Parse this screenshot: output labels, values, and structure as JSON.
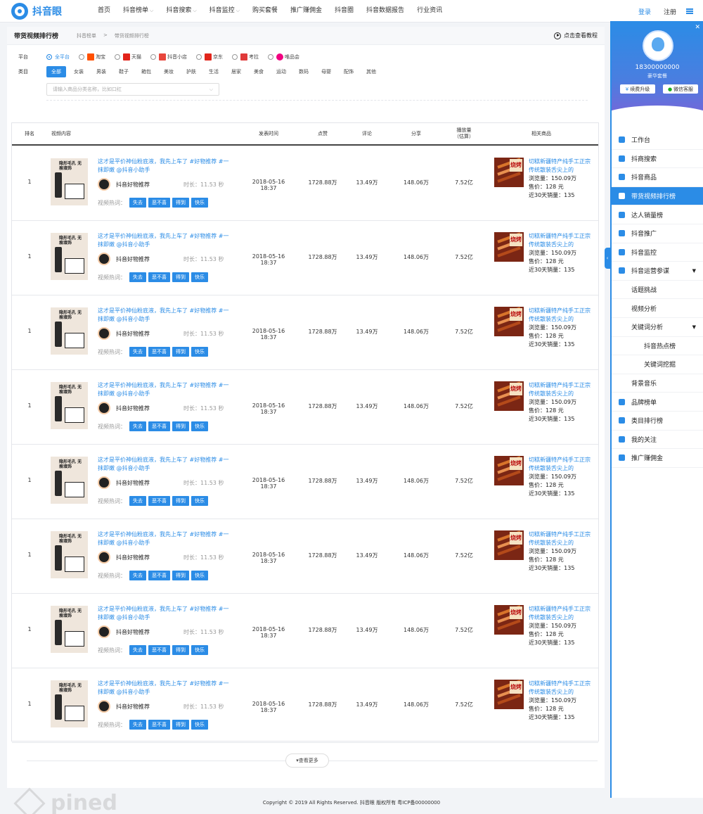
{
  "brand": {
    "name": "抖音眼"
  },
  "nav": {
    "items": [
      {
        "label": "首页",
        "caret": false
      },
      {
        "label": "抖音榜单",
        "caret": true
      },
      {
        "label": "抖音搜索",
        "caret": true
      },
      {
        "label": "抖音监控",
        "caret": true
      },
      {
        "label": "购买套餐",
        "caret": false
      },
      {
        "label": "推广赚佣金",
        "caret": false
      },
      {
        "label": "抖音圈",
        "caret": false
      },
      {
        "label": "抖音数据报告",
        "caret": false
      },
      {
        "label": "行业资讯",
        "caret": false
      }
    ],
    "login": "登录",
    "register": "注册"
  },
  "page": {
    "title": "带货视频排行榜",
    "breadcrumb": [
      "抖音榜单",
      ">",
      "带货视频排行榜"
    ],
    "tutorial": "点击查看教程"
  },
  "filters": {
    "platform_label": "平台",
    "platforms": [
      {
        "label": "全平台",
        "selected": true,
        "color": ""
      },
      {
        "label": "淘宝",
        "selected": false,
        "color": "#ff5000"
      },
      {
        "label": "天猫",
        "selected": false,
        "color": "#e2231a"
      },
      {
        "label": "抖音小店",
        "selected": false,
        "color": "#e8463c"
      },
      {
        "label": "京东",
        "selected": false,
        "color": "#e1251b"
      },
      {
        "label": "考拉",
        "selected": false,
        "color": "#e03a3a"
      },
      {
        "label": "唯品会",
        "selected": false,
        "color": "#f10180"
      }
    ],
    "category_label": "类目",
    "categories": [
      {
        "label": "全部",
        "selected": true
      },
      {
        "label": "女装",
        "selected": false
      },
      {
        "label": "男装",
        "selected": false
      },
      {
        "label": "鞋子",
        "selected": false
      },
      {
        "label": "箱包",
        "selected": false
      },
      {
        "label": "美妆",
        "selected": false
      },
      {
        "label": "护肤",
        "selected": false
      },
      {
        "label": "生活",
        "selected": false
      },
      {
        "label": "居家",
        "selected": false
      },
      {
        "label": "美食",
        "selected": false
      },
      {
        "label": "运动",
        "selected": false
      },
      {
        "label": "数码",
        "selected": false
      },
      {
        "label": "母婴",
        "selected": false
      },
      {
        "label": "配饰",
        "selected": false
      },
      {
        "label": "其他",
        "selected": false
      }
    ],
    "search_placeholder": "请输入商品分类名称，比如口红"
  },
  "table": {
    "headers": {
      "rank": "排名",
      "video": "视频内容",
      "date": "发表时间",
      "likes": "点赞",
      "comments": "评论",
      "shares": "分享",
      "plays": "播放量\n（估算）",
      "product": "相关商品"
    },
    "rows": [
      {
        "rank": "1",
        "thumb_caption": "隐形毛孔 无痕填饰",
        "title": "这才是平价神仙粉底液，我先上车了 #好物推荐 #一抹即嫩 @抖音小助手",
        "author": "抖音好物推荐",
        "duration": "时长：11.53 秒",
        "hot_label": "视频热词：",
        "tags": [
          "失去",
          "恶不喜",
          "得到",
          "快乐"
        ],
        "date": "2018-05-16 18:37",
        "likes": "1728.88万",
        "comments": "13.49万",
        "shares": "148.06万",
        "plays": "7.52亿",
        "product": {
          "thumb_label": "烧烤",
          "name": "切糕新疆特产纯手工正宗传统散装舌尖上的",
          "views": "浏览量：150.09万",
          "price": "售价：128 元",
          "sales": "近30天销量：135"
        }
      },
      {
        "rank": "1",
        "thumb_caption": "隐形毛孔 无痕填饰",
        "title": "这才是平价神仙粉底液，我先上车了 #好物推荐 #一抹即嫩 @抖音小助手",
        "author": "抖音好物推荐",
        "duration": "时长：11.53 秒",
        "hot_label": "视频热词：",
        "tags": [
          "失去",
          "恶不喜",
          "得到",
          "快乐"
        ],
        "date": "2018-05-16 18:37",
        "likes": "1728.88万",
        "comments": "13.49万",
        "shares": "148.06万",
        "plays": "7.52亿",
        "product": {
          "thumb_label": "烧烤",
          "name": "切糕新疆特产纯手工正宗传统散装舌尖上的",
          "views": "浏览量：150.09万",
          "price": "售价：128 元",
          "sales": "近30天销量：135"
        }
      },
      {
        "rank": "1",
        "thumb_caption": "隐形毛孔 无痕填饰",
        "title": "这才是平价神仙粉底液，我先上车了 #好物推荐 #一抹即嫩 @抖音小助手",
        "author": "抖音好物推荐",
        "duration": "时长：11.53 秒",
        "hot_label": "视频热词：",
        "tags": [
          "失去",
          "恶不喜",
          "得到",
          "快乐"
        ],
        "date": "2018-05-16 18:37",
        "likes": "1728.88万",
        "comments": "13.49万",
        "shares": "148.06万",
        "plays": "7.52亿",
        "product": {
          "thumb_label": "烧烤",
          "name": "切糕新疆特产纯手工正宗传统散装舌尖上的",
          "views": "浏览量：150.09万",
          "price": "售价：128 元",
          "sales": "近30天销量：135"
        }
      },
      {
        "rank": "1",
        "thumb_caption": "隐形毛孔 无痕填饰",
        "title": "这才是平价神仙粉底液，我先上车了 #好物推荐 #一抹即嫩 @抖音小助手",
        "author": "抖音好物推荐",
        "duration": "时长：11.53 秒",
        "hot_label": "视频热词：",
        "tags": [
          "失去",
          "恶不喜",
          "得到",
          "快乐"
        ],
        "date": "2018-05-16 18:37",
        "likes": "1728.88万",
        "comments": "13.49万",
        "shares": "148.06万",
        "plays": "7.52亿",
        "product": {
          "thumb_label": "烧烤",
          "name": "切糕新疆特产纯手工正宗传统散装舌尖上的",
          "views": "浏览量：150.09万",
          "price": "售价：128 元",
          "sales": "近30天销量：135"
        }
      },
      {
        "rank": "1",
        "thumb_caption": "隐形毛孔 无痕填饰",
        "title": "这才是平价神仙粉底液，我先上车了 #好物推荐 #一抹即嫩 @抖音小助手",
        "author": "抖音好物推荐",
        "duration": "时长：11.53 秒",
        "hot_label": "视频热词：",
        "tags": [
          "失去",
          "恶不喜",
          "得到",
          "快乐"
        ],
        "date": "2018-05-16 18:37",
        "likes": "1728.88万",
        "comments": "13.49万",
        "shares": "148.06万",
        "plays": "7.52亿",
        "product": {
          "thumb_label": "烧烤",
          "name": "切糕新疆特产纯手工正宗传统散装舌尖上的",
          "views": "浏览量：150.09万",
          "price": "售价：128 元",
          "sales": "近30天销量：135"
        }
      },
      {
        "rank": "1",
        "thumb_caption": "隐形毛孔 无痕填饰",
        "title": "这才是平价神仙粉底液，我先上车了 #好物推荐 #一抹即嫩 @抖音小助手",
        "author": "抖音好物推荐",
        "duration": "时长：11.53 秒",
        "hot_label": "视频热词：",
        "tags": [
          "失去",
          "恶不喜",
          "得到",
          "快乐"
        ],
        "date": "2018-05-16 18:37",
        "likes": "1728.88万",
        "comments": "13.49万",
        "shares": "148.06万",
        "plays": "7.52亿",
        "product": {
          "thumb_label": "烧烤",
          "name": "切糕新疆特产纯手工正宗传统散装舌尖上的",
          "views": "浏览量：150.09万",
          "price": "售价：128 元",
          "sales": "近30天销量：135"
        }
      },
      {
        "rank": "1",
        "thumb_caption": "隐形毛孔 无痕填饰",
        "title": "这才是平价神仙粉底液，我先上车了 #好物推荐 #一抹即嫩 @抖音小助手",
        "author": "抖音好物推荐",
        "duration": "时长：11.53 秒",
        "hot_label": "视频热词：",
        "tags": [
          "失去",
          "恶不喜",
          "得到",
          "快乐"
        ],
        "date": "2018-05-16 18:37",
        "likes": "1728.88万",
        "comments": "13.49万",
        "shares": "148.06万",
        "plays": "7.52亿",
        "product": {
          "thumb_label": "烧烤",
          "name": "切糕新疆特产纯手工正宗传统散装舌尖上的",
          "views": "浏览量：150.09万",
          "price": "售价：128 元",
          "sales": "近30天销量：135"
        }
      },
      {
        "rank": "1",
        "thumb_caption": "隐形毛孔 无痕填饰",
        "title": "这才是平价神仙粉底液，我先上车了 #好物推荐 #一抹即嫩 @抖音小助手",
        "author": "抖音好物推荐",
        "duration": "时长：11.53 秒",
        "hot_label": "视频热词：",
        "tags": [
          "失去",
          "恶不喜",
          "得到",
          "快乐"
        ],
        "date": "2018-05-16 18:37",
        "likes": "1728.88万",
        "comments": "13.49万",
        "shares": "148.06万",
        "plays": "7.52亿",
        "product": {
          "thumb_label": "烧烤",
          "name": "切糕新疆特产纯手工正宗传统散装舌尖上的",
          "views": "浏览量：150.09万",
          "price": "售价：128 元",
          "sales": "近30天销量：135"
        }
      }
    ]
  },
  "load_more": "▾查看更多",
  "watermark": "pined",
  "footer": "Copyright © 2019  All Rights Reserved. 抖音眼 版权所有  粤ICP备00000000",
  "sidebar": {
    "phone": "18300000000",
    "plan": "豪华套餐",
    "renew_button": "续费升级",
    "wechat_button": "微信客服",
    "menu": [
      {
        "label": "工作台",
        "level": 0,
        "icon": "bar-chart-icon",
        "active": false,
        "expand": false
      },
      {
        "label": "抖商搜索",
        "level": 0,
        "icon": "search-icon",
        "active": false,
        "expand": false
      },
      {
        "label": "抖音商品",
        "level": 0,
        "icon": "product-icon",
        "active": false,
        "expand": false
      },
      {
        "label": "带货视频排行榜",
        "level": 0,
        "icon": "video-icon",
        "active": true,
        "expand": false
      },
      {
        "label": "达人销量榜",
        "level": 0,
        "icon": "list-icon",
        "active": false,
        "expand": false
      },
      {
        "label": "抖音推广",
        "level": 0,
        "icon": "list-icon",
        "active": false,
        "expand": false
      },
      {
        "label": "抖音监控",
        "level": 0,
        "icon": "camera-icon",
        "active": false,
        "expand": false
      },
      {
        "label": "抖音运营参谋",
        "level": 0,
        "icon": "compass-icon",
        "active": false,
        "expand": true
      },
      {
        "label": "话题挑战",
        "level": 1,
        "icon": "",
        "active": false,
        "expand": false
      },
      {
        "label": "视频分析",
        "level": 1,
        "icon": "",
        "active": false,
        "expand": false
      },
      {
        "label": "关键词分析",
        "level": 1,
        "icon": "",
        "active": false,
        "expand": true
      },
      {
        "label": "抖音热点榜",
        "level": 2,
        "icon": "",
        "active": false,
        "expand": false
      },
      {
        "label": "关键词挖掘",
        "level": 2,
        "icon": "",
        "active": false,
        "expand": false
      },
      {
        "label": "背景音乐",
        "level": 1,
        "icon": "",
        "active": false,
        "expand": false
      },
      {
        "label": "品牌榜单",
        "level": 0,
        "icon": "target-icon",
        "active": false,
        "expand": false
      },
      {
        "label": "类目排行榜",
        "level": 0,
        "icon": "image-icon",
        "active": false,
        "expand": false
      },
      {
        "label": "我的关注",
        "level": 0,
        "icon": "eye-icon",
        "active": false,
        "expand": false
      },
      {
        "label": "推广赚佣金",
        "level": 0,
        "icon": "money-icon",
        "active": false,
        "expand": false
      }
    ]
  },
  "colors": {
    "accent": "#2b8ce6",
    "active_menu": "#2b8ce6"
  }
}
